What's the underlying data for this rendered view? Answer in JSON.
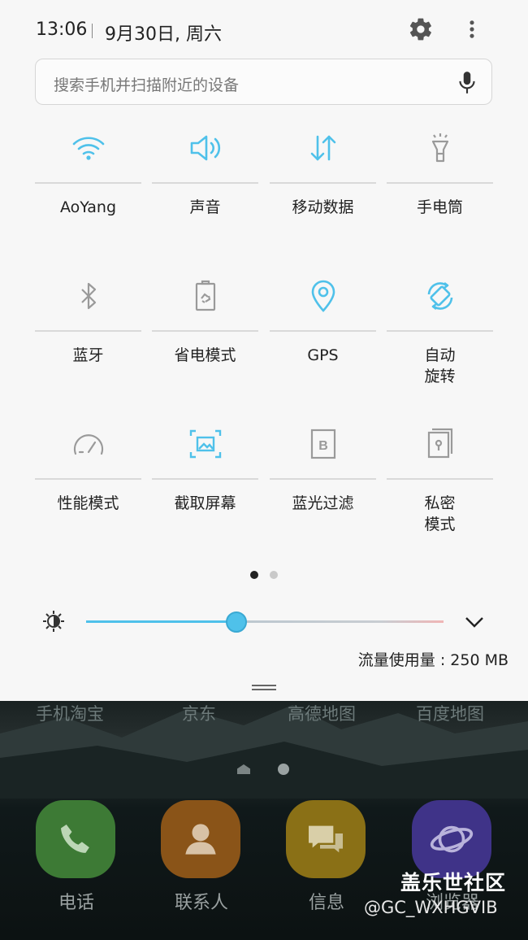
{
  "status": {
    "time": "13:06",
    "date": "9月30日, 周六"
  },
  "search": {
    "placeholder": "搜索手机并扫描附近的设备"
  },
  "tiles": [
    {
      "label": "AoYang",
      "icon": "wifi-icon",
      "active": true
    },
    {
      "label": "声音",
      "icon": "volume-icon",
      "active": true
    },
    {
      "label": "移动数据",
      "icon": "mobile-data-icon",
      "active": true
    },
    {
      "label": "手电筒",
      "icon": "flashlight-icon",
      "active": false
    },
    {
      "label": "蓝牙",
      "icon": "bluetooth-icon",
      "active": false
    },
    {
      "label": "省电模式",
      "icon": "power-saving-icon",
      "active": false
    },
    {
      "label": "GPS",
      "icon": "location-icon",
      "active": true
    },
    {
      "label": "自动\n旋转",
      "icon": "auto-rotate-icon",
      "active": true
    },
    {
      "label": "性能模式",
      "icon": "performance-icon",
      "active": false
    },
    {
      "label": "截取屏幕",
      "icon": "screenshot-icon",
      "active": true
    },
    {
      "label": "蓝光过滤",
      "icon": "blue-light-filter-icon",
      "active": false
    },
    {
      "label": "私密\n模式",
      "icon": "private-mode-icon",
      "active": false
    }
  ],
  "brightness": {
    "level": 0.42
  },
  "data_usage": {
    "text": "流量使用量 : 250 MB"
  },
  "home": {
    "top_apps": [
      "手机淘宝",
      "京东",
      "高德地图",
      "百度地图"
    ],
    "dock": [
      "电话",
      "联系人",
      "信息",
      "浏览器"
    ]
  },
  "watermark": {
    "line1": "盖乐世社区",
    "line2": "@GC_WXHGVIB"
  },
  "colors": {
    "accent": "#4fc1ea",
    "inactive": "#9a9a9a",
    "panel": "#f7f7f7"
  }
}
